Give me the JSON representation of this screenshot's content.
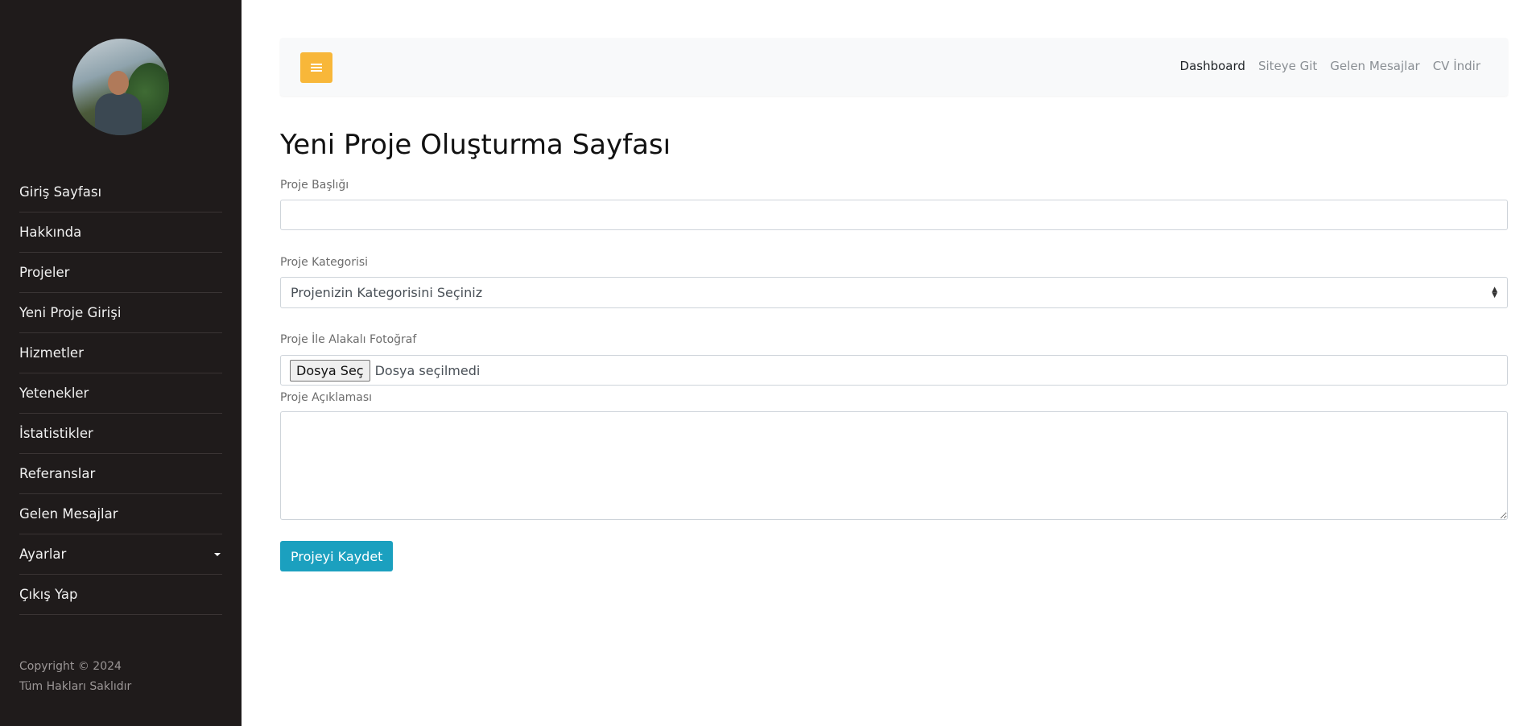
{
  "sidebar": {
    "menu": [
      {
        "label": "Giriş Sayfası"
      },
      {
        "label": "Hakkında"
      },
      {
        "label": "Projeler"
      },
      {
        "label": "Yeni Proje Girişi"
      },
      {
        "label": "Hizmetler"
      },
      {
        "label": "Yetenekler"
      },
      {
        "label": "İstatistikler"
      },
      {
        "label": "Referanslar"
      },
      {
        "label": "Gelen Mesajlar"
      },
      {
        "label": "Ayarlar",
        "has_submenu": true
      },
      {
        "label": "Çıkış Yap"
      }
    ],
    "copyright_line1": "Copyright © 2024",
    "copyright_line2": "Tüm Hakları Saklıdır"
  },
  "navbar": {
    "toggle_icon": "hamburger-icon",
    "links": [
      "Dashboard",
      "Siteye Git",
      "Gelen Mesajlar",
      "CV İndir"
    ],
    "active_link": "Dashboard",
    "toggle_color": "#f8b739"
  },
  "form": {
    "page_title": "Yeni Proje Oluşturma Sayfası",
    "title_label": "Proje Başlığı",
    "title_value": "",
    "category_label": "Proje Kategorisi",
    "category_selected": "Projenizin Kategorisini Seçiniz",
    "photo_label": "Proje İle Alakalı Fotoğraf",
    "file_button": "Dosya Seç",
    "file_status": "Dosya seçilmedi",
    "description_label": "Proje Açıklaması",
    "description_value": "",
    "submit_label": "Projeyi Kaydet",
    "submit_color": "#1ba0bf"
  }
}
